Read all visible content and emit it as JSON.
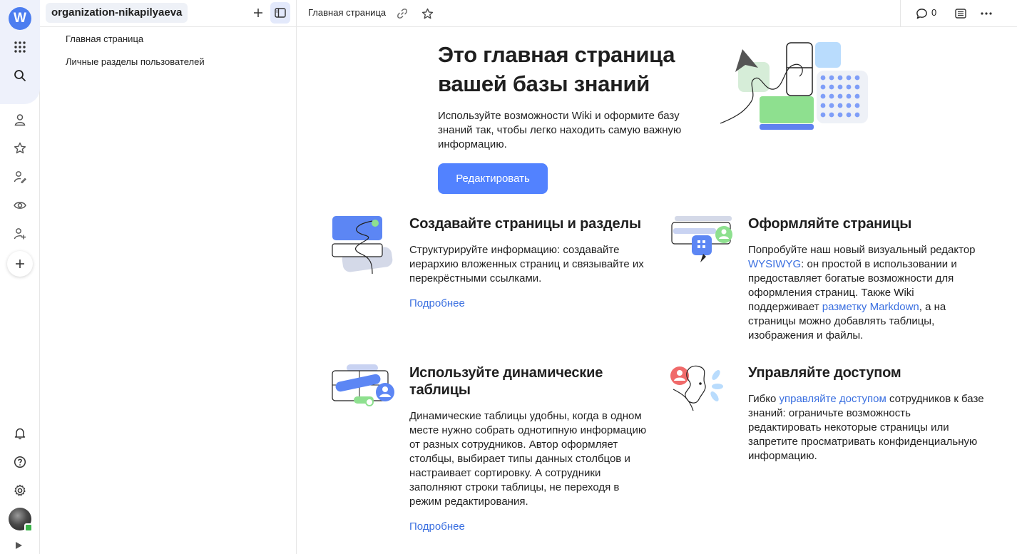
{
  "rail": {
    "logo_letter": "W",
    "icons": [
      "apps-grid-icon",
      "search-icon",
      "user-icon",
      "star-icon",
      "pen-user-icon",
      "eye-icon",
      "add-user-icon",
      "plus-icon",
      "bell-icon",
      "help-icon",
      "gear-icon"
    ]
  },
  "tree": {
    "org_name": "organization-nikapilyaeva",
    "items": [
      {
        "label": "Главная страница"
      },
      {
        "label": "Личные разделы пользователей"
      }
    ]
  },
  "header": {
    "title": "Главная страница",
    "comments_count": "0"
  },
  "hero": {
    "title_line1": "Это главная страница",
    "title_line2": "вашей базы знаний",
    "desc_line1": "Используйте возможности Wiki и оформите базу",
    "desc_line2": "знаний так, чтобы легко находить самую важную",
    "desc_line3": "информацию.",
    "edit_label": "Редактировать"
  },
  "sections": [
    {
      "title": "Создавайте страницы и разделы",
      "lines": [
        "Структурируйте информацию: создавайте",
        "иерархию вложенных страниц и связывайте их",
        "перекрёстными ссылками."
      ],
      "more": "Подробнее"
    },
    {
      "title": "Оформляйте страницы",
      "line1": "Попробуйте наш новый визуальный редактор",
      "link1": "WYSIWYG",
      "line2_rest": ": он простой в использовании и",
      "line3": "предоставляет богатые возможности для",
      "line4": "оформления страниц. Также Wiki",
      "line5_pre": "поддерживает ",
      "link2": "разметку Markdown",
      "line5_post": ", а на",
      "line6": "страницы можно добавлять таблицы,",
      "line7": "изображения и файлы."
    },
    {
      "title_line1": "Используйте динамические",
      "title_line2": "таблицы",
      "lines": [
        "Динамические таблицы удобны, когда в одном",
        "месте нужно собрать однотипную информацию",
        "от разных сотрудников. Автор оформляет",
        "столбцы, выбирает типы данных столбцов и",
        "настраивает сортировку. А сотрудники",
        "заполняют строки таблицы, не переходя в",
        "режим редактирования."
      ],
      "more": "Подробнее"
    },
    {
      "title": "Управляйте доступом",
      "line1_pre": "Гибко ",
      "link": "управляйте доступом",
      "line1_post": " сотрудников к базе",
      "line2": "знаний: ограничьте возможность",
      "line3": "редактировать некоторые страницы или",
      "line4": "запретите просматривать конфиденциальную",
      "line5": "информацию."
    }
  ],
  "colors": {
    "accent": "#5282ff",
    "link": "#3a6fe0",
    "rail_highlight": "#eef1fb"
  }
}
